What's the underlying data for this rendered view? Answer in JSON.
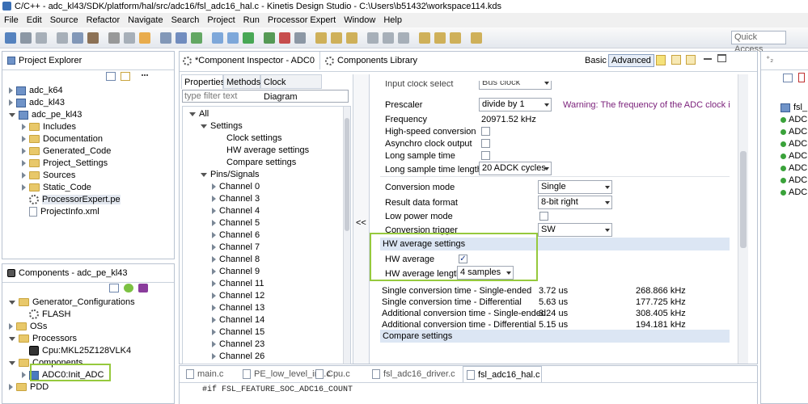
{
  "window": {
    "title": "C/C++ - adc_kl43/SDK/platform/hal/src/adc16/fsl_adc16_hal.c - Kinetis Design Studio - C:\\Users\\b51432\\workspace114.kds"
  },
  "menu": [
    "File",
    "Edit",
    "Source",
    "Refactor",
    "Navigate",
    "Search",
    "Project",
    "Run",
    "Processor Expert",
    "Window",
    "Help"
  ],
  "toolbar": {
    "quick_access": "Quick Access"
  },
  "project_explorer": {
    "title": "Project Explorer",
    "items": [
      {
        "label": "adc_k64",
        "level": 0,
        "type": "project"
      },
      {
        "label": "adc_kl43",
        "level": 0,
        "type": "project"
      },
      {
        "label": "adc_pe_kl43",
        "level": 0,
        "type": "project",
        "open": true
      },
      {
        "label": "Includes",
        "level": 1,
        "type": "folder"
      },
      {
        "label": "Documentation",
        "level": 1,
        "type": "folder"
      },
      {
        "label": "Generated_Code",
        "level": 1,
        "type": "folder"
      },
      {
        "label": "Project_Settings",
        "level": 1,
        "type": "folder"
      },
      {
        "label": "Sources",
        "level": 1,
        "type": "folder"
      },
      {
        "label": "Static_Code",
        "level": 1,
        "type": "folder"
      },
      {
        "label": "ProcessorExpert.pe",
        "level": 1,
        "type": "pe"
      },
      {
        "label": "ProjectInfo.xml",
        "level": 1,
        "type": "file"
      }
    ]
  },
  "components": {
    "title": "Components - adc_pe_kl43",
    "items": [
      {
        "label": "Generator_Configurations",
        "level": 0,
        "type": "folder",
        "open": true
      },
      {
        "label": "FLASH",
        "level": 1,
        "type": "gear"
      },
      {
        "label": "OSs",
        "level": 0,
        "type": "folder"
      },
      {
        "label": "Processors",
        "level": 0,
        "type": "folder",
        "open": true
      },
      {
        "label": "Cpu:MKL25Z128VLK4",
        "level": 1,
        "type": "chip"
      },
      {
        "label": "Components",
        "level": 0,
        "type": "folder",
        "open": true
      },
      {
        "label": "ADC0:Init_ADC",
        "level": 1,
        "type": "comp"
      },
      {
        "label": "PDD",
        "level": 0,
        "type": "folder"
      }
    ]
  },
  "inspector": {
    "title": "*Component Inspector - ADC0",
    "library_tab": "Components Library",
    "mode_basic": "Basic",
    "mode_advanced": "Advanced",
    "tabs": [
      "Properties",
      "Methods",
      "Clock Diagram"
    ],
    "filter_placeholder": "type filter text",
    "tree": [
      {
        "label": "All",
        "level": 0,
        "open": true
      },
      {
        "label": "Settings",
        "level": 1,
        "open": true
      },
      {
        "label": "Clock settings",
        "level": 2
      },
      {
        "label": "HW average settings",
        "level": 2
      },
      {
        "label": "Compare settings",
        "level": 2
      },
      {
        "label": "Pins/Signals",
        "level": 1,
        "open": true
      },
      {
        "label": "Channel 0",
        "level": 2,
        "tw": true
      },
      {
        "label": "Channel 3",
        "level": 2,
        "tw": true
      },
      {
        "label": "Channel 4",
        "level": 2,
        "tw": true
      },
      {
        "label": "Channel 5",
        "level": 2,
        "tw": true
      },
      {
        "label": "Channel 6",
        "level": 2,
        "tw": true
      },
      {
        "label": "Channel 7",
        "level": 2,
        "tw": true
      },
      {
        "label": "Channel 8",
        "level": 2,
        "tw": true
      },
      {
        "label": "Channel 9",
        "level": 2,
        "tw": true
      },
      {
        "label": "Channel 11",
        "level": 2,
        "tw": true
      },
      {
        "label": "Channel 12",
        "level": 2,
        "tw": true
      },
      {
        "label": "Channel 13",
        "level": 2,
        "tw": true
      },
      {
        "label": "Channel 14",
        "level": 2,
        "tw": true
      },
      {
        "label": "Channel 15",
        "level": 2,
        "tw": true
      },
      {
        "label": "Channel 23",
        "level": 2,
        "tw": true
      },
      {
        "label": "Channel 26",
        "level": 2,
        "tw": true
      }
    ],
    "collapse_label": "<<",
    "props": {
      "input_clock_label": "Input clock select",
      "input_clock_value": "Bus clock",
      "prescaler_label": "Prescaler",
      "prescaler_value": "divide by 1",
      "warning": "Warning: The frequency of the ADC clock is ...",
      "frequency_label": "Frequency",
      "frequency_value": "20971.52 kHz",
      "hs_label": "High-speed conversion",
      "async_label": "Asynchro clock output",
      "lst_label": "Long sample time",
      "lstl_label": "Long sample time length",
      "lstl_value": "20 ADCK cycles",
      "mode_label": "Conversion mode",
      "mode_value": "Single",
      "format_label": "Result data format",
      "format_value": "8-bit right",
      "lowpower_label": "Low power mode",
      "trigger_label": "Conversion trigger",
      "trigger_value": "SW",
      "hwavg_section": "HW average settings",
      "hwavg_label": "HW average",
      "hwavg_checked": true,
      "hwavgl_label": "HW average length",
      "hwavgl_value": "4 samples",
      "timing": [
        {
          "label": "Single conversion time - Single-ended",
          "time": "3.72 us",
          "freq": "268.866 kHz"
        },
        {
          "label": "Single conversion time - Differential",
          "time": "5.63 us",
          "freq": "177.725 kHz"
        },
        {
          "label": "Additional conversion time - Single-ended",
          "time": "3.24 us",
          "freq": "308.405 kHz"
        },
        {
          "label": "Additional conversion time - Differential",
          "time": "5.15 us",
          "freq": "194.181 kHz"
        }
      ],
      "compare_section": "Compare settings"
    }
  },
  "editor": {
    "tabs": [
      "main.c",
      "PE_low_level_init.c",
      "Cpu.c",
      "fsl_adc16_driver.c",
      "fsl_adc16_hal.c"
    ],
    "active_tab": "fsl_adc16_hal.c",
    "code_line": "#if FSL_FEATURE_SOC_ADC16_COUNT"
  },
  "outline": {
    "items": [
      "fsl_",
      "ADC",
      "ADC",
      "ADC",
      "ADC",
      "ADC",
      "ADC",
      "ADC"
    ]
  },
  "colors": {
    "highlight": "#96c93d",
    "section": "#dce6f4",
    "warning": "#7a1f7a"
  }
}
